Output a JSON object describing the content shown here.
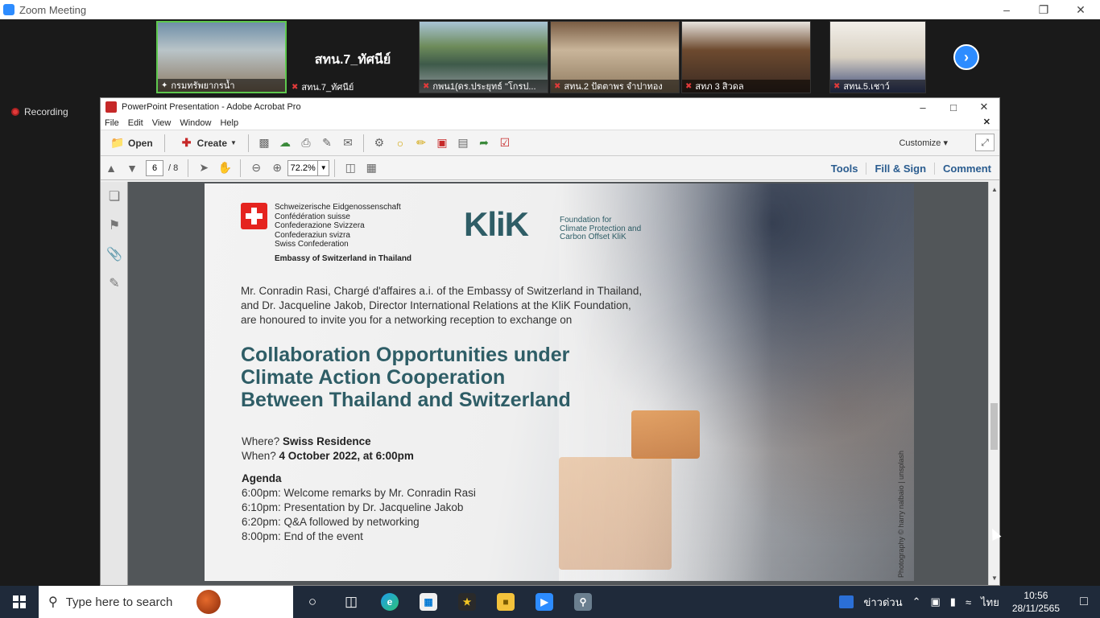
{
  "zoom": {
    "title": "Zoom Meeting",
    "recording_label": "Recording",
    "participants": [
      {
        "name": "กรมทรัพยากรน้ำ",
        "muted": false,
        "active": true
      },
      {
        "name": "สทน.7_ทัศนีย์",
        "muted": true,
        "display_name": "สทน.7_ทัศนีย์"
      },
      {
        "name": "กพน1(ดร.ประยุทธ์ \"โกรป...",
        "muted": true
      },
      {
        "name": "สทน.2 ปัตตาพร จำปาทอง",
        "muted": true
      },
      {
        "name": "สทภ 3 สิวดล",
        "muted": true
      },
      {
        "name": "สทน.5.เชาว์",
        "muted": true
      }
    ]
  },
  "acrobat": {
    "title": "PowerPoint Presentation - Adobe Acrobat Pro",
    "menu": [
      "File",
      "Edit",
      "View",
      "Window",
      "Help"
    ],
    "open_label": "Open",
    "create_label": "Create",
    "customize_label": "Customize",
    "current_page": "6",
    "total_pages": "/ 8",
    "zoom_level": "72.2%",
    "links": {
      "tools": "Tools",
      "fill_sign": "Fill & Sign",
      "comment": "Comment"
    }
  },
  "document": {
    "confederation_lines": [
      "Schweizerische Eidgenossenschaft",
      "Confédération suisse",
      "Confederazione Svizzera",
      "Confederaziun svizra",
      "Swiss Confederation"
    ],
    "embassy": "Embassy of Switzerland in Thailand",
    "klik_logo": "KliK",
    "klik_sub": [
      "Foundation for",
      "Climate Protection and",
      "Carbon Offset KliK"
    ],
    "invitation": [
      "Mr. Conradin Rasi, Chargé d'affaires a.i. of the Embassy of Switzerland in Thailand,",
      "and Dr. Jacqueline Jakob, Director International Relations at the KliK Foundation,",
      "are honoured to invite you for a networking reception to exchange on"
    ],
    "headline": [
      "Collaboration Opportunities under",
      "Climate Action Cooperation",
      "Between Thailand and Switzerland"
    ],
    "where_label": "Where?",
    "where_value": "Swiss Residence",
    "when_label": "When?",
    "when_value": "4 October 2022, at 6:00pm",
    "agenda_title": "Agenda",
    "agenda": [
      "6:00pm: Welcome remarks by Mr. Conradin Rasi",
      "6:10pm: Presentation by Dr. Jacqueline Jakob",
      "6:20pm: Q&A followed by networking",
      "8:00pm: End of the event"
    ],
    "photo_credit": "Photography © harry nalbaio | unsplash"
  },
  "taskbar": {
    "search_placeholder": "Type here to search",
    "news_label": "ข่าวด่วน",
    "lang": "ไทย",
    "time": "10:56",
    "date": "28/11/2565"
  }
}
